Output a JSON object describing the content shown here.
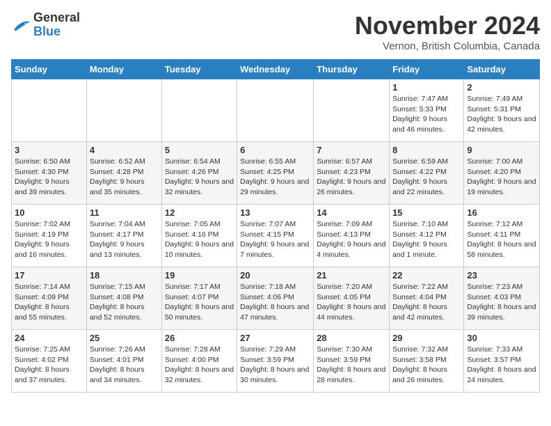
{
  "header": {
    "logo_general": "General",
    "logo_blue": "Blue",
    "month_title": "November 2024",
    "location": "Vernon, British Columbia, Canada"
  },
  "days_of_week": [
    "Sunday",
    "Monday",
    "Tuesday",
    "Wednesday",
    "Thursday",
    "Friday",
    "Saturday"
  ],
  "weeks": [
    [
      {
        "day": "",
        "info": ""
      },
      {
        "day": "",
        "info": ""
      },
      {
        "day": "",
        "info": ""
      },
      {
        "day": "",
        "info": ""
      },
      {
        "day": "",
        "info": ""
      },
      {
        "day": "1",
        "info": "Sunrise: 7:47 AM\nSunset: 5:33 PM\nDaylight: 9 hours and 46 minutes."
      },
      {
        "day": "2",
        "info": "Sunrise: 7:49 AM\nSunset: 5:31 PM\nDaylight: 9 hours and 42 minutes."
      }
    ],
    [
      {
        "day": "3",
        "info": "Sunrise: 6:50 AM\nSunset: 4:30 PM\nDaylight: 9 hours and 39 minutes."
      },
      {
        "day": "4",
        "info": "Sunrise: 6:52 AM\nSunset: 4:28 PM\nDaylight: 9 hours and 35 minutes."
      },
      {
        "day": "5",
        "info": "Sunrise: 6:54 AM\nSunset: 4:26 PM\nDaylight: 9 hours and 32 minutes."
      },
      {
        "day": "6",
        "info": "Sunrise: 6:55 AM\nSunset: 4:25 PM\nDaylight: 9 hours and 29 minutes."
      },
      {
        "day": "7",
        "info": "Sunrise: 6:57 AM\nSunset: 4:23 PM\nDaylight: 9 hours and 26 minutes."
      },
      {
        "day": "8",
        "info": "Sunrise: 6:59 AM\nSunset: 4:22 PM\nDaylight: 9 hours and 22 minutes."
      },
      {
        "day": "9",
        "info": "Sunrise: 7:00 AM\nSunset: 4:20 PM\nDaylight: 9 hours and 19 minutes."
      }
    ],
    [
      {
        "day": "10",
        "info": "Sunrise: 7:02 AM\nSunset: 4:19 PM\nDaylight: 9 hours and 16 minutes."
      },
      {
        "day": "11",
        "info": "Sunrise: 7:04 AM\nSunset: 4:17 PM\nDaylight: 9 hours and 13 minutes."
      },
      {
        "day": "12",
        "info": "Sunrise: 7:05 AM\nSunset: 4:16 PM\nDaylight: 9 hours and 10 minutes."
      },
      {
        "day": "13",
        "info": "Sunrise: 7:07 AM\nSunset: 4:15 PM\nDaylight: 9 hours and 7 minutes."
      },
      {
        "day": "14",
        "info": "Sunrise: 7:09 AM\nSunset: 4:13 PM\nDaylight: 9 hours and 4 minutes."
      },
      {
        "day": "15",
        "info": "Sunrise: 7:10 AM\nSunset: 4:12 PM\nDaylight: 9 hours and 1 minute."
      },
      {
        "day": "16",
        "info": "Sunrise: 7:12 AM\nSunset: 4:11 PM\nDaylight: 8 hours and 58 minutes."
      }
    ],
    [
      {
        "day": "17",
        "info": "Sunrise: 7:14 AM\nSunset: 4:09 PM\nDaylight: 8 hours and 55 minutes."
      },
      {
        "day": "18",
        "info": "Sunrise: 7:15 AM\nSunset: 4:08 PM\nDaylight: 8 hours and 52 minutes."
      },
      {
        "day": "19",
        "info": "Sunrise: 7:17 AM\nSunset: 4:07 PM\nDaylight: 8 hours and 50 minutes."
      },
      {
        "day": "20",
        "info": "Sunrise: 7:18 AM\nSunset: 4:06 PM\nDaylight: 8 hours and 47 minutes."
      },
      {
        "day": "21",
        "info": "Sunrise: 7:20 AM\nSunset: 4:05 PM\nDaylight: 8 hours and 44 minutes."
      },
      {
        "day": "22",
        "info": "Sunrise: 7:22 AM\nSunset: 4:04 PM\nDaylight: 8 hours and 42 minutes."
      },
      {
        "day": "23",
        "info": "Sunrise: 7:23 AM\nSunset: 4:03 PM\nDaylight: 8 hours and 39 minutes."
      }
    ],
    [
      {
        "day": "24",
        "info": "Sunrise: 7:25 AM\nSunset: 4:02 PM\nDaylight: 8 hours and 37 minutes."
      },
      {
        "day": "25",
        "info": "Sunrise: 7:26 AM\nSunset: 4:01 PM\nDaylight: 8 hours and 34 minutes."
      },
      {
        "day": "26",
        "info": "Sunrise: 7:28 AM\nSunset: 4:00 PM\nDaylight: 8 hours and 32 minutes."
      },
      {
        "day": "27",
        "info": "Sunrise: 7:29 AM\nSunset: 3:59 PM\nDaylight: 8 hours and 30 minutes."
      },
      {
        "day": "28",
        "info": "Sunrise: 7:30 AM\nSunset: 3:59 PM\nDaylight: 8 hours and 28 minutes."
      },
      {
        "day": "29",
        "info": "Sunrise: 7:32 AM\nSunset: 3:58 PM\nDaylight: 8 hours and 26 minutes."
      },
      {
        "day": "30",
        "info": "Sunrise: 7:33 AM\nSunset: 3:57 PM\nDaylight: 8 hours and 24 minutes."
      }
    ]
  ]
}
